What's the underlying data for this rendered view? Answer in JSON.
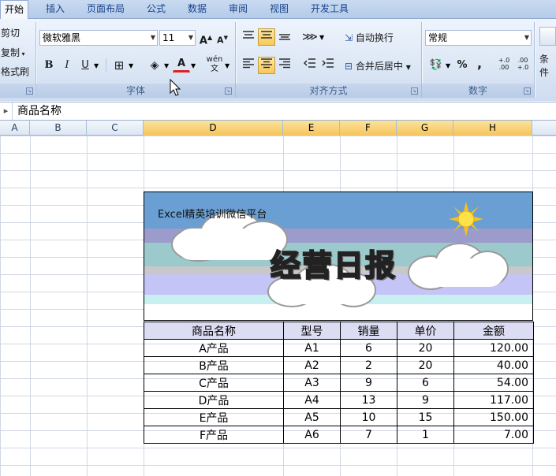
{
  "tabs": [
    {
      "label": "开始",
      "active": true
    },
    {
      "label": "插入"
    },
    {
      "label": "页面布局"
    },
    {
      "label": "公式"
    },
    {
      "label": "数据"
    },
    {
      "label": "审阅"
    },
    {
      "label": "视图"
    },
    {
      "label": "开发工具"
    }
  ],
  "clipboard": {
    "cut": "剪切",
    "copy": "复制",
    "format_painter": "格式刷"
  },
  "font": {
    "name": "微软雅黑",
    "size": "11",
    "group_label": "字体"
  },
  "alignment": {
    "wrap_text": "自动换行",
    "merge_center": "合并后居中",
    "group_label": "对齐方式"
  },
  "number": {
    "format": "常规",
    "percent": "%",
    "comma": ",",
    "inc_decimal": "+.0 .00",
    "dec_decimal": ".00 +.0",
    "group_label": "数字"
  },
  "styles": {
    "conditional": "条件"
  },
  "formula_bar": {
    "content": "商品名称"
  },
  "columns": [
    "A",
    "B",
    "C",
    "D",
    "E",
    "F",
    "G",
    "H"
  ],
  "selected_column": "D",
  "banner": {
    "subtitle": "Excel精英培训微信平台",
    "title": "经营日报"
  },
  "table": {
    "headers": [
      "商品名称",
      "型号",
      "销量",
      "单价",
      "金额"
    ],
    "rows": [
      [
        "A产品",
        "A1",
        "6",
        "20",
        "120.00"
      ],
      [
        "B产品",
        "A2",
        "2",
        "20",
        "40.00"
      ],
      [
        "C产品",
        "A3",
        "9",
        "6",
        "54.00"
      ],
      [
        "D产品",
        "A4",
        "13",
        "9",
        "117.00"
      ],
      [
        "E产品",
        "A5",
        "10",
        "15",
        "150.00"
      ],
      [
        "F产品",
        "A6",
        "7",
        "1",
        "7.00"
      ]
    ]
  },
  "colors": {
    "header_fill": "#dcdcf3",
    "selected_col": "#f6c45b",
    "ribbon": "#dde8f6"
  }
}
